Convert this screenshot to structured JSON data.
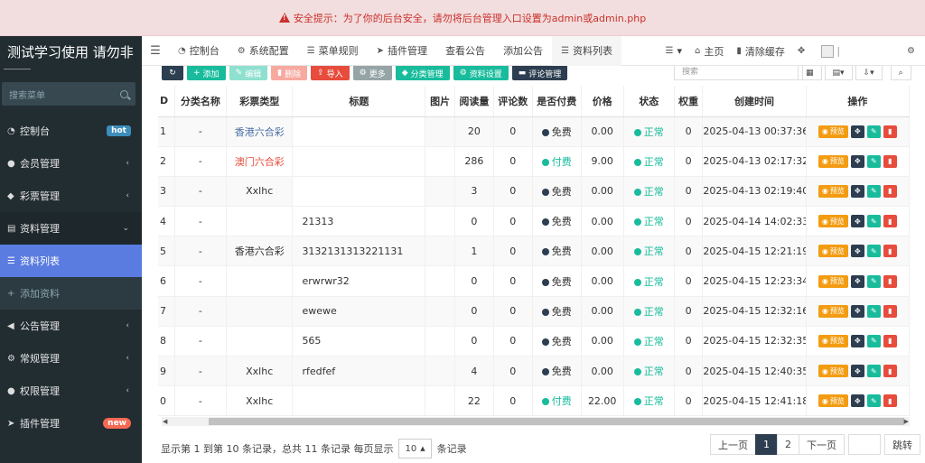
{
  "alert": "安全提示：为了你的后台安全，请勿将后台管理入口设置为admin或admin.php",
  "brand": "测试学习使用 请勿非",
  "sidebar": {
    "search_placeholder": "搜索菜单",
    "items": [
      {
        "label": "控制台",
        "icon": "dashboard-icon",
        "badge": "hot"
      },
      {
        "label": "会员管理",
        "icon": "user-icon"
      },
      {
        "label": "彩票管理",
        "icon": "tag-icon"
      },
      {
        "label": "资料管理",
        "icon": "file-icon"
      },
      {
        "label": "资料列表",
        "icon": "list-icon"
      },
      {
        "label": "添加资料",
        "icon": "plus-icon"
      },
      {
        "label": "公告管理",
        "icon": "bullhorn-icon"
      },
      {
        "label": "常规管理",
        "icon": "cogs-icon"
      },
      {
        "label": "权限管理",
        "icon": "group-icon"
      },
      {
        "label": "插件管理",
        "icon": "rocket-icon",
        "badge": "new"
      }
    ]
  },
  "topnav": {
    "tabs": [
      {
        "label": "控制台",
        "icon": "dashboard-icon"
      },
      {
        "label": "系统配置",
        "icon": "gear-icon"
      },
      {
        "label": "菜单规则",
        "icon": "list-icon"
      },
      {
        "label": "插件管理",
        "icon": "rocket-icon"
      },
      {
        "label": "查看公告"
      },
      {
        "label": "添加公告"
      },
      {
        "label": "资料列表",
        "icon": "list-icon"
      }
    ],
    "right": {
      "home": "主页",
      "clear_cache": "清除缓存"
    }
  },
  "toolbar": {
    "add": "添加",
    "edit": "编辑",
    "delete": "删除",
    "import": "导入",
    "more": "更多",
    "category": "分类管理",
    "data_settings": "资料设置",
    "comment_mgmt": "评论管理",
    "search_placeholder": "搜索"
  },
  "table": {
    "headers": [
      "D",
      "分类名称",
      "彩票类型",
      "标题",
      "图片",
      "阅读量",
      "评论数",
      "是否付费",
      "价格",
      "状态",
      "权重",
      "创建时间",
      "操作"
    ],
    "rows": [
      {
        "id": "1",
        "cat": "-",
        "type": "香港六合彩",
        "tclass": "hk",
        "title": "",
        "white": true,
        "views": "20",
        "comments": "0",
        "pay": "免费",
        "price": "0.00",
        "status": "正常",
        "weight": "0",
        "time": "2025-04-13 00:37:36"
      },
      {
        "id": "2",
        "cat": "-",
        "type": "澳门六合彩",
        "tclass": "mo",
        "title": "",
        "white": true,
        "views": "286",
        "comments": "0",
        "pay": "付费",
        "price": "9.00",
        "status": "正常",
        "weight": "0",
        "time": "2025-04-13 02:17:32"
      },
      {
        "id": "3",
        "cat": "-",
        "type": "Xxlhc",
        "tclass": "",
        "title": "",
        "white": true,
        "views": "3",
        "comments": "0",
        "pay": "免费",
        "price": "0.00",
        "status": "正常",
        "weight": "0",
        "time": "2025-04-13 02:19:40"
      },
      {
        "id": "4",
        "cat": "-",
        "type": "",
        "tclass": "",
        "title": "21313",
        "views": "0",
        "comments": "0",
        "pay": "免费",
        "price": "0.00",
        "status": "正常",
        "weight": "0",
        "time": "2025-04-14 14:02:33"
      },
      {
        "id": "5",
        "cat": "-",
        "type": "香港六合彩",
        "tclass": "",
        "title": "3132131313221131",
        "views": "1",
        "comments": "0",
        "pay": "免费",
        "price": "0.00",
        "status": "正常",
        "weight": "0",
        "time": "2025-04-15 12:21:19"
      },
      {
        "id": "6",
        "cat": "-",
        "type": "",
        "tclass": "",
        "title": "erwrwr32",
        "views": "0",
        "comments": "0",
        "pay": "免费",
        "price": "0.00",
        "status": "正常",
        "weight": "0",
        "time": "2025-04-15 12:23:34"
      },
      {
        "id": "7",
        "cat": "-",
        "type": "",
        "tclass": "",
        "title": "ewewe",
        "views": "0",
        "comments": "0",
        "pay": "免费",
        "price": "0.00",
        "status": "正常",
        "weight": "0",
        "time": "2025-04-15 12:32:16"
      },
      {
        "id": "8",
        "cat": "-",
        "type": "",
        "tclass": "",
        "title": "565",
        "views": "0",
        "comments": "0",
        "pay": "免费",
        "price": "0.00",
        "status": "正常",
        "weight": "0",
        "time": "2025-04-15 12:32:35"
      },
      {
        "id": "9",
        "cat": "-",
        "type": "Xxlhc",
        "tclass": "",
        "title": "rfedfef",
        "views": "4",
        "comments": "0",
        "pay": "免费",
        "price": "0.00",
        "status": "正常",
        "weight": "0",
        "time": "2025-04-15 12:40:35"
      },
      {
        "id": "0",
        "cat": "-",
        "type": "Xxlhc",
        "tclass": "",
        "title": "",
        "views": "22",
        "comments": "0",
        "pay": "付费",
        "price": "22.00",
        "status": "正常",
        "weight": "0",
        "time": "2025-04-15 12:41:18"
      }
    ],
    "op_preview": "预览"
  },
  "pagination": {
    "info": "显示第 1 到第 10 条记录，总共 11 条记录 每页显示",
    "page_size": "10",
    "suffix": "条记录",
    "prev": "上一页",
    "pages": [
      "1",
      "2"
    ],
    "next": "下一页",
    "go": "跳转"
  },
  "colors": {
    "sidebar_bg": "#222d32",
    "active_menu": "#5a7be0",
    "green": "#18bc9c",
    "red": "#e74c3c",
    "orange": "#f39c12",
    "dark": "#2c3e50"
  }
}
